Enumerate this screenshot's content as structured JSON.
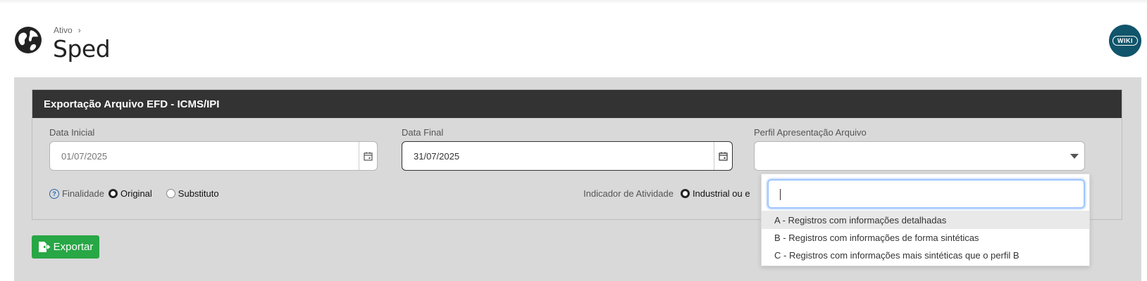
{
  "header": {
    "breadcrumb": "Ativo",
    "title": "Sped",
    "wiki_label": "WIKI"
  },
  "panel": {
    "title": "Exportação Arquivo EFD - ICMS/IPI",
    "data_inicial": {
      "label": "Data Inicial",
      "value": "01/07/2025"
    },
    "data_final": {
      "label": "Data Final",
      "value": "31/07/2025"
    },
    "perfil": {
      "label": "Perfil Apresentação Arquivo",
      "value": ""
    },
    "finalidade": {
      "label": "Finalidade",
      "options": [
        "Original",
        "Substituto"
      ],
      "selected": "Original"
    },
    "indicador": {
      "label": "Indicador de Atividade",
      "visible_option": "Industrial ou e"
    }
  },
  "export_button": {
    "label": "Exportar"
  },
  "dropdown": {
    "search_value": "",
    "options": [
      "A - Registros com informações detalhadas",
      "B - Registros com informações de forma sintéticas",
      "C - Registros com informações mais sintéticas que o perfil B"
    ],
    "highlighted_index": 0
  },
  "colors": {
    "panel_header": "#333333",
    "export_button": "#27a745",
    "wiki_badge": "#10556b",
    "background_area": "#d9d9d9"
  }
}
